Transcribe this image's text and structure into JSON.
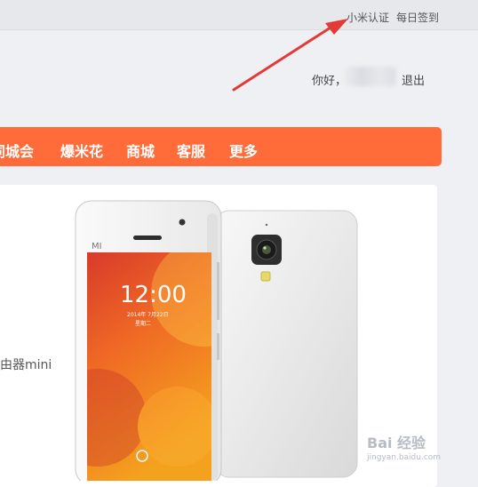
{
  "topbar": {
    "mi_auth": "小米认证",
    "daily_signin": "每日签到"
  },
  "user": {
    "greeting": "你好，",
    "logout": "退出"
  },
  "nav": {
    "items": [
      "同城会",
      "爆米花",
      "商城",
      "客服",
      "更多"
    ]
  },
  "content": {
    "text_fragment": "由器mini",
    "phone_front": {
      "brand_mark": "MI",
      "time": "12:00",
      "date": "2014年 7月22日",
      "weekday": "星期二"
    }
  },
  "watermark": {
    "main": "Bai 经验",
    "sub": "jingyan.baidu.com"
  },
  "colors": {
    "nav_bg": "#ff6c3a",
    "annotation_arrow": "#e53935"
  }
}
